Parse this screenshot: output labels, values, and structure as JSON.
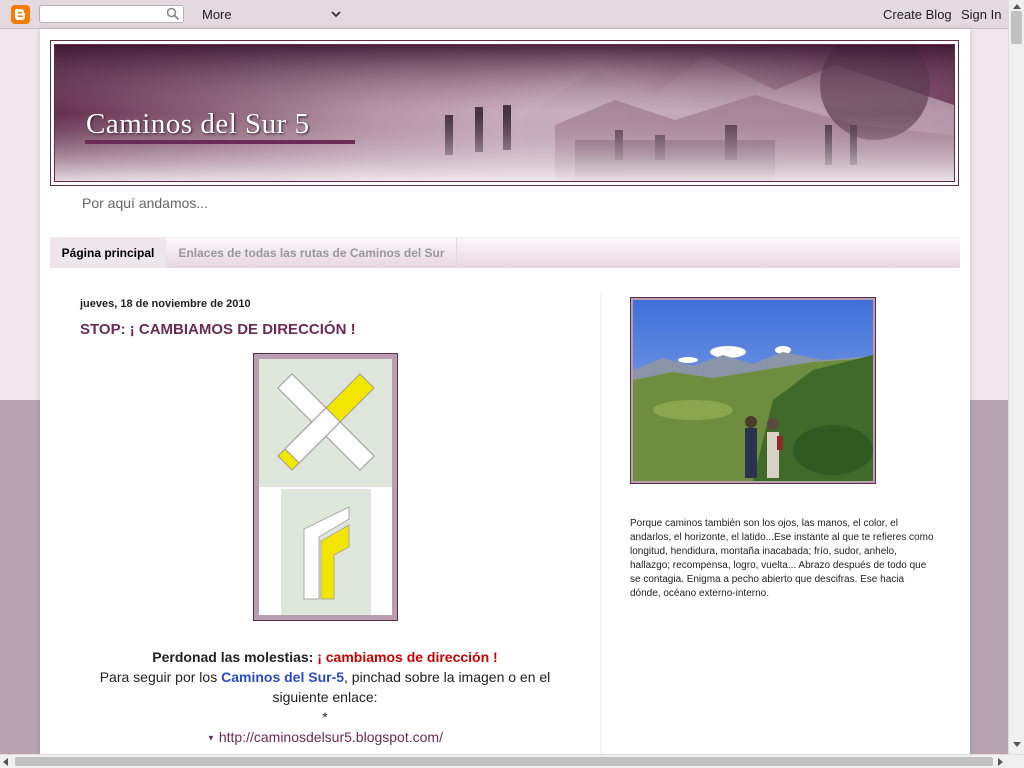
{
  "navbar": {
    "logo": "blogger-icon",
    "search_placeholder": "",
    "more_label": "More",
    "create_blog": "Create Blog",
    "sign_in": "Sign In"
  },
  "header": {
    "title": "Caminos del Sur 5"
  },
  "tagline": "Por aquí andamos...",
  "tabs": [
    {
      "label": "Página principal",
      "active": true
    },
    {
      "label": "Enlaces de todas las rutas de Caminos del Sur",
      "active": false
    }
  ],
  "post": {
    "date": "jueves, 18 de noviembre de 2010",
    "title": "STOP: ¡ CAMBIAMOS DE DIRECCIÓN !",
    "line1_a": "Perdonad las molestias: ",
    "line1_b": "¡ cambiamos de dirección !",
    "line2_a": "Para seguir por los ",
    "line2_b": "Caminos del Sur-5",
    "line2_c": ", pinchad sobre la imagen o en el siguiente enlace:",
    "star": "*",
    "link": "http://caminosdelsur5.blogspot.com/"
  },
  "sidebar": {
    "text": "Porque caminos también son los ojos, las manos, el color, el andarlos, el horizonte, el latido...Ese instante al que te refieres como longitud, hendidura, montaña inacabada; frío, sudor, anhelo, hallazgo; recompensa, logro, vuelta... Abrazo después de todo que se contagia. Enigma a pecho abierto que descifras. Ese hacia dónde, océano externo-interno."
  },
  "colors": {
    "accent": "#6c2b56",
    "background": "#b7a4b0",
    "link_red": "#cc0000",
    "link_blue": "#2b4acb"
  }
}
